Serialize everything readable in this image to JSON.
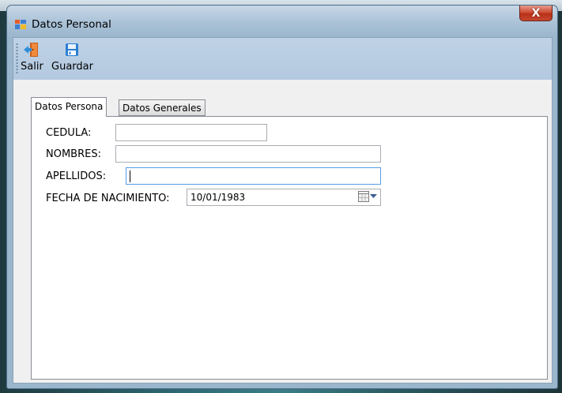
{
  "window": {
    "title": "Datos Personal",
    "close_glyph": "X"
  },
  "toolbar": {
    "buttons": [
      {
        "label": "Salir",
        "icon": "exit-door-icon"
      },
      {
        "label": "Guardar",
        "icon": "save-disk-icon"
      }
    ]
  },
  "tabs": [
    {
      "label": "Datos Persona",
      "active": true
    },
    {
      "label": "Datos Generales",
      "active": false
    }
  ],
  "form": {
    "cedula": {
      "label": "CEDULA:",
      "value": ""
    },
    "nombres": {
      "label": "NOMBRES:",
      "value": ""
    },
    "apellidos": {
      "label": "APELLIDOS:",
      "value": ""
    },
    "fecha_nacimiento": {
      "label": "FECHA DE NACIMIENTO:",
      "value": "10/01/1983"
    }
  },
  "colors": {
    "toolbar_bg": "#b3c9df",
    "close_button": "#c5482f",
    "focus_border": "#569de5"
  }
}
